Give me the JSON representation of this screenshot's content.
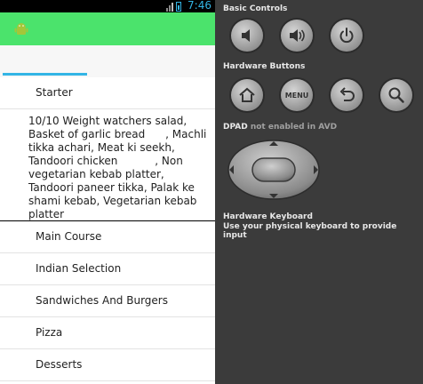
{
  "status": {
    "time": "7:46"
  },
  "list": {
    "starter": "Starter",
    "starter_items": "10/10 Weight watchers salad, Basket of garlic bread      , Machli tikka achari, Meat ki seekh, Tandoori chicken           , Non vegetarian kebab platter, Tandoori paneer tikka, Palak ke shami kebab, Vegetarian kebab platter",
    "categories": [
      "Main Course",
      "Indian Selection",
      "Sandwiches And Burgers",
      "Pizza",
      "Desserts"
    ]
  },
  "emulator": {
    "basic_controls": "Basic Controls",
    "hardware_buttons": "Hardware Buttons",
    "menu_label": "MENU",
    "dpad": "DPAD",
    "dpad_note": "not enabled in AVD",
    "hardware_keyboard": "Hardware Keyboard",
    "keyboard_hint": "Use your physical keyboard to provide input"
  },
  "colors": {
    "actionbar": "#4be36c",
    "accent": "#33b5e5",
    "panel": "#3b3b3b"
  }
}
